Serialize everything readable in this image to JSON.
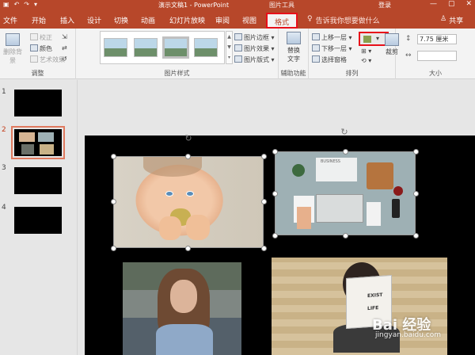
{
  "titlebar": {
    "doc_title": "演示文稿1 - PowerPoint",
    "context_title": "图片工具",
    "login": "登录"
  },
  "tabs": [
    "文件",
    "开始",
    "插入",
    "设计",
    "切换",
    "动画",
    "幻灯片放映",
    "审阅",
    "视图",
    "格式"
  ],
  "tellme": "告诉我你想要做什么",
  "share": "共享",
  "ribbon": {
    "adjust": {
      "remove_bg": "删除背景",
      "correct": "校正",
      "color": "颜色",
      "artistic": "艺术效果",
      "label": "调整"
    },
    "styles": {
      "border": "图片边框",
      "effect": "图片效果",
      "layout": "图片版式",
      "label": "图片样式"
    },
    "accessibility": {
      "alt_text_line1": "替换",
      "alt_text_line2": "文字",
      "label": "辅助功能"
    },
    "arrange": {
      "bring_forward": "上移一层",
      "send_backward": "下移一层",
      "selection_pane": "选择窗格",
      "label": "排列"
    },
    "size": {
      "crop": "裁剪",
      "width_value": "7.75 厘米",
      "label": "大小"
    }
  },
  "slides": [
    {
      "num": "1"
    },
    {
      "num": "2"
    },
    {
      "num": "3"
    },
    {
      "num": "4"
    }
  ],
  "picture_text": {
    "desk_folder": "BUSINESS",
    "book_line1": "EXIST",
    "book_line2": "LIFE"
  },
  "watermark": {
    "brand": "Bai 经验",
    "url": "jingyan.baidu.com"
  },
  "colors": {
    "accent": "#b7472a",
    "highlight_box": "#e8101a",
    "slide_bg": "#000000"
  }
}
